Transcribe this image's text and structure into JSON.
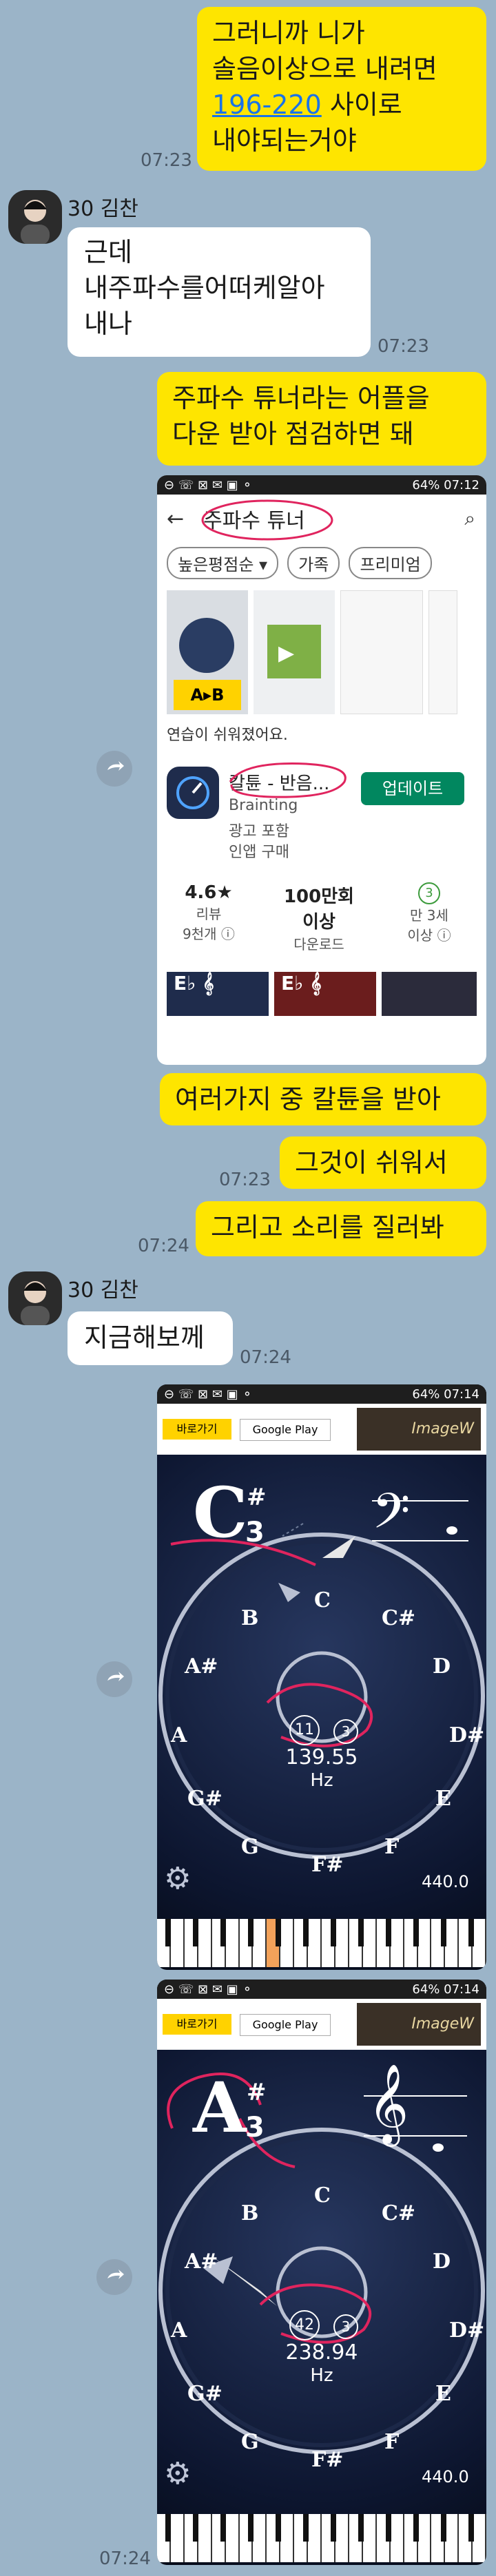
{
  "messages": {
    "m1": {
      "text_l1": "그러니까 니가",
      "text_l2": "솔음이상으로 내려면",
      "link": "196-220",
      "text_l3_rest": " 사이로",
      "text_l4": "내야되는거야",
      "time": "07:23"
    },
    "sender_name": "30 김찬",
    "m2": {
      "text_l1": "근데",
      "text_l2": "내주파수를어떠케알아",
      "text_l3": "내나",
      "time": "07:23"
    },
    "m3": {
      "text_l1": "주파수 튜너라는 어플을",
      "text_l2": "다운 받아 점검하면 돼"
    },
    "m4": {
      "text": "여러가지 중 칼튠을 받아"
    },
    "m5": {
      "text": "그것이 쉬워서",
      "time": "07:23"
    },
    "m6": {
      "text": "그리고 소리를 질러봐",
      "time": "07:24"
    },
    "m7": {
      "text": "지금해보께",
      "time": "07:24"
    },
    "final_time": "07:24"
  },
  "store_screenshot": {
    "status_right": "64% 07:12",
    "search_query": "주파수 튜너",
    "filters": [
      "높은평점순 ▾",
      "가족",
      "프리미엄"
    ],
    "promo_text": "연습이 쉬워졌어요.",
    "app_name": "칼튠 - 반음...",
    "developer": "Brainting",
    "meta1": "광고 포함",
    "meta2": "인앱 구매",
    "update_button": "업데이트",
    "rating": "4.6★",
    "rating_label": "리뷰",
    "reviews": "9천개 ⓘ",
    "downloads": "100만회",
    "downloads_l2": "이상",
    "downloads_label": "다운로드",
    "age_badge": "3",
    "age_label": "만 3세",
    "age_label2": "이상 ⓘ"
  },
  "tuner1": {
    "status_right": "64% 07:14",
    "ad_button": "바로가기",
    "ad_store": "Google Play",
    "ad_brand": "ImageW",
    "note": "C",
    "octave": "3",
    "sharp": "#",
    "cents": "11",
    "badge": "3",
    "freq": "139.55",
    "unit": "Hz",
    "ref": "440.0"
  },
  "tuner2": {
    "status_right": "64% 07:14",
    "ad_button": "바로가기",
    "ad_store": "Google Play",
    "ad_brand": "ImageW",
    "note": "A",
    "octave": "3",
    "sharp": "#",
    "cents": "42",
    "badge": "3",
    "freq": "238.94",
    "unit": "Hz",
    "ref": "440.0"
  },
  "dial_labels": {
    "C": "C",
    "Cs": "C#",
    "D": "D",
    "Ds": "D#",
    "E": "E",
    "F": "F",
    "Fs": "F#",
    "G": "G",
    "Gs": "G#",
    "A": "A",
    "As": "A#",
    "B": "B"
  },
  "colors": {
    "chat_bg": "#9bb4c8",
    "bubble_yellow": "#fee500",
    "install_green": "#01875f",
    "annotation": "#e0245e"
  }
}
